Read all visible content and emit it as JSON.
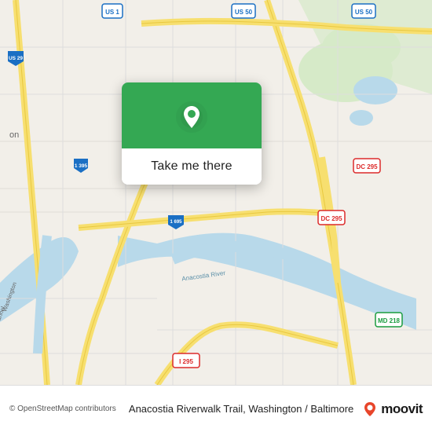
{
  "map": {
    "alt": "Map of Washington DC / Baltimore area",
    "attribution": "© OpenStreetMap contributors",
    "attribution_link": "https://www.openstreetmap.org/copyright"
  },
  "popup": {
    "button_label": "Take me there",
    "icon_name": "location-pin-icon"
  },
  "bottom_bar": {
    "attribution_text": "© OpenStreetMap contributors",
    "location_name": "Anacostia Riverwalk Trail, Washington / Baltimore",
    "moovit_label": "moovit"
  },
  "colors": {
    "green": "#34a853",
    "road_yellow": "#f7df6f",
    "road_orange": "#f5a623",
    "water_blue": "#a8d4e8",
    "land_light": "#f2efe9",
    "land_green": "#d6eac8"
  }
}
